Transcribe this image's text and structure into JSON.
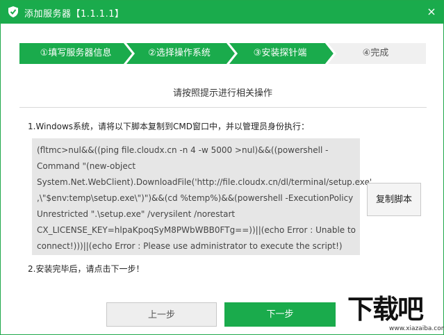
{
  "window": {
    "title": "添加服务器【1.1.1.1】",
    "close_glyph": "×",
    "accent": "#1aab4c"
  },
  "steps": [
    {
      "label": "①填写服务器信息",
      "state": "done"
    },
    {
      "label": "②选择操作系统",
      "state": "done"
    },
    {
      "label": "③安装探针端",
      "state": "active"
    },
    {
      "label": "④完成",
      "state": "pending"
    }
  ],
  "subtitle": "请按照提示进行相关操作",
  "instruction1": "1.Windows系统，请将以下脚本复制到CMD窗口中，并以管理员身份执行：",
  "script_lines": [
    "(fltmc>nul&&((ping file.cloudx.cn -n 4 -w 5000 >nul)&&((powershell -",
    "Command \"(new-object",
    "System.Net.WebClient).DownloadFile('http://file.cloudx.cn/dl/terminal/setup.exe'",
    ",\\\"$env:temp\\setup.exe\\\")\")&&(cd %temp%)&&(powershell -ExecutionPolicy",
    "Unrestricted \".\\setup.exe\" /verysilent /norestart",
    "CX_LICENSE_KEY=hlpaKpoqSyM8PWbWBB0FTg==))||(echo Error : Unable to",
    "connect!)))||(echo Error : Please use administrator to execute the script!)"
  ],
  "copy_button": "复制脚本",
  "instruction2": "2.安装完毕后，请点击下一步！",
  "prev_button": "上一步",
  "next_button": "下一步",
  "watermark": {
    "main": "下载吧",
    "url": "www.xiazaiba.com"
  }
}
